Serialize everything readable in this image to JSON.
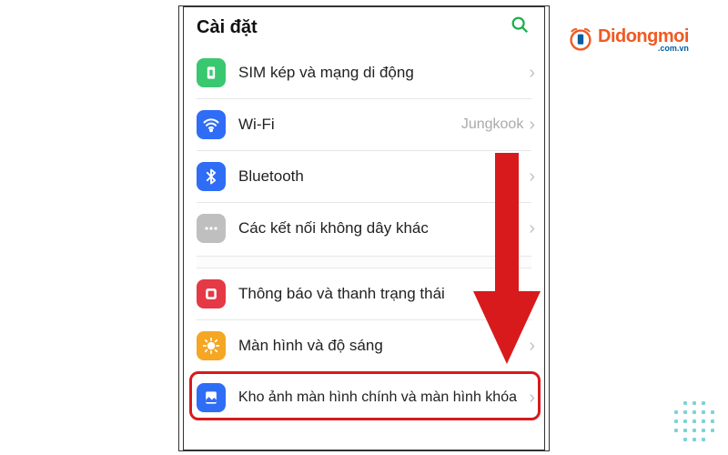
{
  "header": {
    "title": "Cài đặt"
  },
  "rows": {
    "sim": {
      "label": "SIM kép và mạng di động"
    },
    "wifi": {
      "label": "Wi-Fi",
      "value": "Jungkook"
    },
    "bluetooth": {
      "label": "Bluetooth"
    },
    "otherwireless": {
      "label": "Các kết nối không dây khác"
    },
    "notifications": {
      "label": "Thông báo và thanh trạng thái"
    },
    "display": {
      "label": "Màn hình và độ sáng"
    },
    "wallpaper": {
      "label": "Kho ảnh màn hình chính và màn hình khóa"
    }
  },
  "logo": {
    "main": "Didongmoi",
    "sub": ".com.vn"
  },
  "colors": {
    "sim": "#39c86f",
    "wifi": "#2f6df6",
    "bluetooth": "#2f6df6",
    "other": "#bfbfbf",
    "notif": "#e63946",
    "display": "#f5a623",
    "wallpaper": "#2f6df6",
    "highlight": "#d81a1c"
  }
}
